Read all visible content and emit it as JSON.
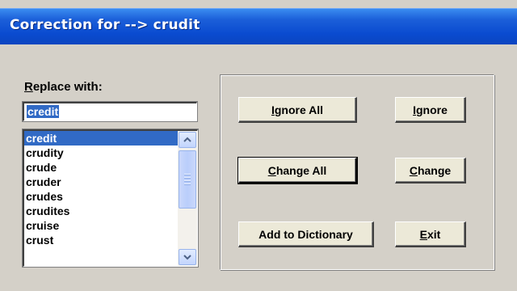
{
  "window": {
    "title": "Correction for --> crudit"
  },
  "replace": {
    "label_accel": "R",
    "label_rest": "eplace with:",
    "value": "credit"
  },
  "suggestions": {
    "items": [
      "credit",
      "crudity",
      "crude",
      "cruder",
      "crudes",
      "crudites",
      "cruise",
      "crust"
    ],
    "selected_index": 0
  },
  "buttons": {
    "ignore_all": {
      "accel": "I",
      "rest": "gnore All"
    },
    "ignore": {
      "accel": "I",
      "rest": "gnore"
    },
    "change_all": {
      "accel": "C",
      "rest": "hange All"
    },
    "change": {
      "accel": "C",
      "rest": "hange"
    },
    "add_to_dictionary": {
      "label": "Add to Dictionary"
    },
    "exit": {
      "accel": "E",
      "rest": "xit"
    }
  },
  "colors": {
    "title_bar": "#0a4bd0",
    "dialog_face": "#d4d0c8",
    "button_face": "#ece9d8",
    "selection": "#316ac5"
  },
  "icons": {
    "scroll_up": "chevron-up-icon",
    "scroll_down": "chevron-down-icon"
  }
}
